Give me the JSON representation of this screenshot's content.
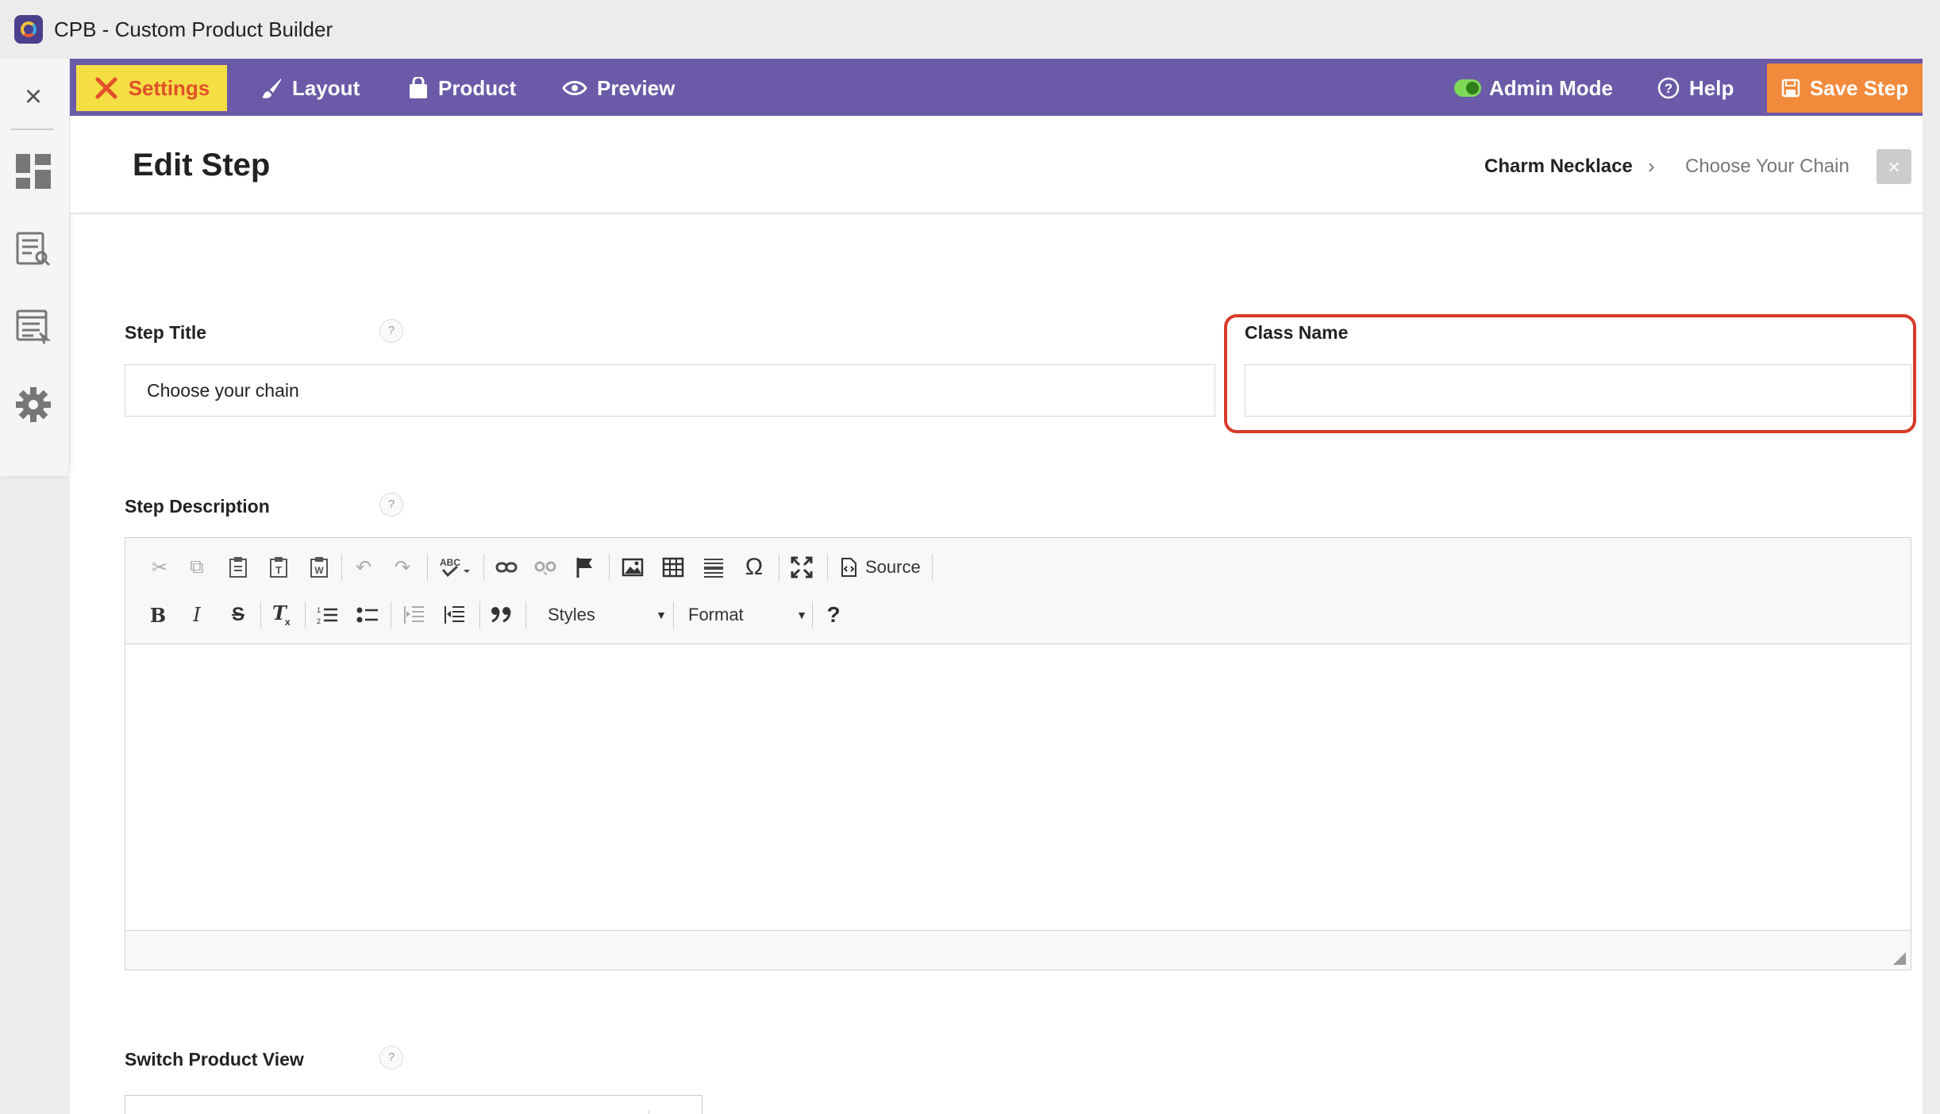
{
  "window": {
    "title": "CPB - Custom Product Builder"
  },
  "sidebar": {
    "icons": [
      "close-icon",
      "dashboard-icon",
      "list-search-icon",
      "settings-list-icon",
      "gear-icon"
    ]
  },
  "nav": {
    "settings": "Settings",
    "layout": "Layout",
    "product": "Product",
    "preview": "Preview",
    "admin_mode": "Admin Mode",
    "help": "Help",
    "save": "Save Step"
  },
  "header": {
    "title": "Edit Step",
    "breadcrumb": [
      "Charm Necklace",
      "Choose Your Chain"
    ],
    "close": "×"
  },
  "form": {
    "step_title_label": "Step Title",
    "step_title_value": "Choose your chain",
    "class_name_label": "Class Name",
    "class_name_value": "",
    "step_description_label": "Step Description",
    "switch_view_label": "Switch Product View",
    "help_glyph": "?"
  },
  "editor": {
    "source_label": "Source",
    "styles_label": "Styles",
    "format_label": "Format",
    "bold": "B",
    "italic": "I",
    "strike": "S",
    "omega": "Ω",
    "help": "?"
  },
  "colors": {
    "nav_bg": "#6a5aa8",
    "settings_bg": "#f5dd44",
    "settings_fg": "#e0502a",
    "save_bg": "#f28a3c",
    "highlight": "#d93a28"
  }
}
